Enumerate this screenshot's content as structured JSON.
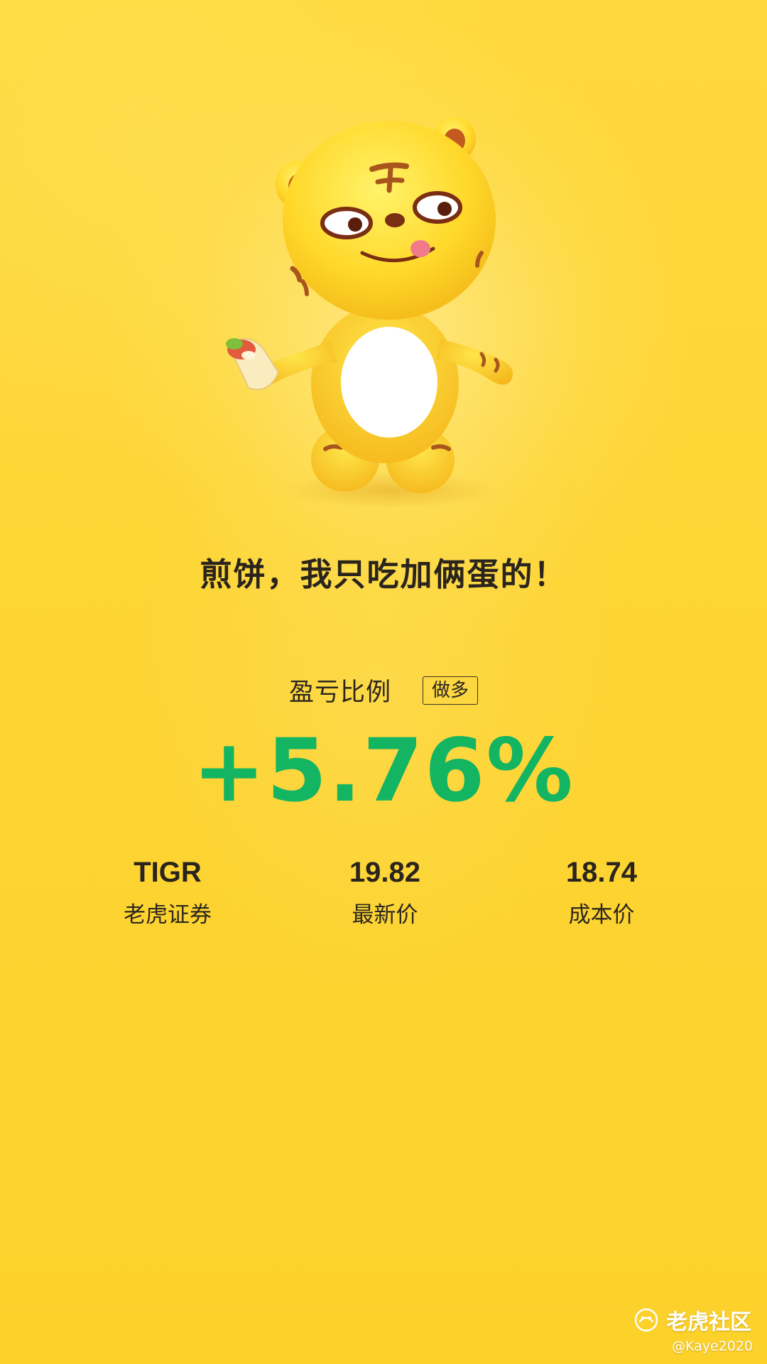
{
  "headline": "煎饼，我只吃加俩蛋的！",
  "profit": {
    "label": "盈亏比例",
    "direction_badge": "做多",
    "percent": "+5.76%",
    "percent_color": "#13b462"
  },
  "stats": [
    {
      "value": "TIGR",
      "label": "老虎证券"
    },
    {
      "value": "19.82",
      "label": "最新价"
    },
    {
      "value": "18.74",
      "label": "成本价"
    }
  ],
  "watermark": {
    "icon": "tiger-logo-icon",
    "text": "老虎社区",
    "handle": "@Kaye2020"
  },
  "mascot": {
    "icon": "tiger-mascot-icon"
  },
  "colors": {
    "background": "#fdd32e",
    "text_dark": "#2a241d",
    "profit_green": "#13b462"
  }
}
